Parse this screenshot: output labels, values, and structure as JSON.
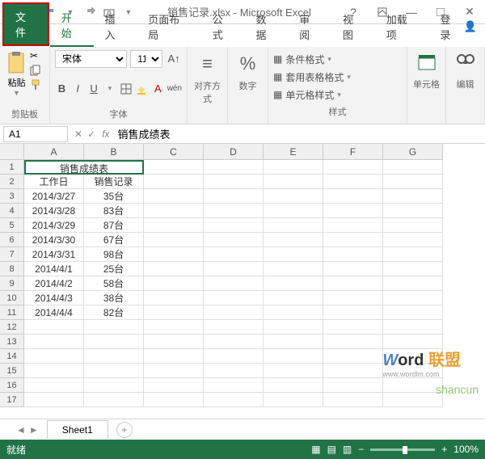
{
  "title": "销售记录.xlsx - Microsoft Excel",
  "tabs": {
    "file": "文件",
    "home": "开始",
    "insert": "插入",
    "layout": "页面布局",
    "formula": "公式",
    "data": "数据",
    "review": "审阅",
    "view": "视图",
    "addins": "加载项",
    "login": "登录"
  },
  "ribbon": {
    "clipboard": "剪贴板",
    "paste": "粘贴",
    "font": "字体",
    "font_name": "宋体",
    "font_size": "11",
    "align": "对齐方式",
    "number": "数字",
    "styles": "样式",
    "cond_format": "条件格式",
    "table_format": "套用表格格式",
    "cell_format": "单元格样式",
    "cells": "单元格",
    "edit": "编辑"
  },
  "namebox": "A1",
  "formula": "销售成绩表",
  "columns": [
    "A",
    "B",
    "C",
    "D",
    "E",
    "F",
    "G"
  ],
  "rows": [
    "1",
    "2",
    "3",
    "4",
    "5",
    "6",
    "7",
    "8",
    "9",
    "10",
    "11",
    "12",
    "13",
    "14",
    "15",
    "16",
    "17"
  ],
  "data": {
    "merged_title": "销售成绩表",
    "header": [
      "工作日",
      "销售记录"
    ],
    "body": [
      [
        "2014/3/27",
        "35台"
      ],
      [
        "2014/3/28",
        "83台"
      ],
      [
        "2014/3/29",
        "87台"
      ],
      [
        "2014/3/30",
        "67台"
      ],
      [
        "2014/3/31",
        "98台"
      ],
      [
        "2014/4/1",
        "25台"
      ],
      [
        "2014/4/2",
        "58台"
      ],
      [
        "2014/4/3",
        "38台"
      ],
      [
        "2014/4/4",
        "82台"
      ]
    ]
  },
  "sheet": "Sheet1",
  "status": "就绪",
  "zoom": "100%",
  "watermark_url": "www.wordlm.com"
}
